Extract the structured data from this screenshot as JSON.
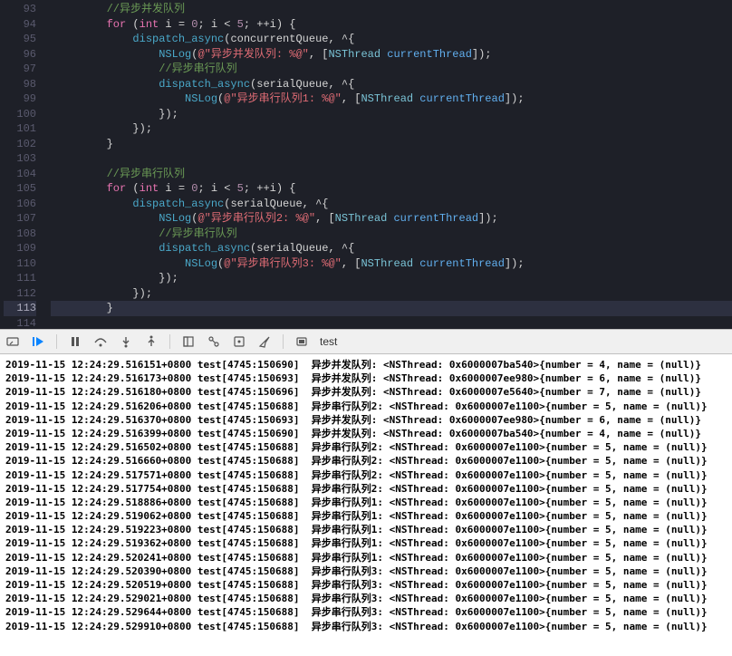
{
  "editor": {
    "lines": [
      {
        "num": 93,
        "tokens": [
          [
            "        ",
            ""
          ],
          [
            "//异步并发队列",
            "c-comment"
          ]
        ]
      },
      {
        "num": 94,
        "tokens": [
          [
            "        ",
            ""
          ],
          [
            "for",
            "c-keyword"
          ],
          [
            " (",
            ""
          ],
          [
            "int",
            "c-keyword"
          ],
          [
            " i = ",
            ""
          ],
          [
            "0",
            "c-num"
          ],
          [
            "; i < ",
            ""
          ],
          [
            "5",
            "c-num"
          ],
          [
            "; ++i) {",
            ""
          ]
        ]
      },
      {
        "num": 95,
        "tokens": [
          [
            "            ",
            ""
          ],
          [
            "dispatch_async",
            "c-func"
          ],
          [
            "(concurrentQueue, ^{",
            ""
          ]
        ]
      },
      {
        "num": 96,
        "tokens": [
          [
            "                ",
            ""
          ],
          [
            "NSLog",
            "c-func"
          ],
          [
            "(",
            ""
          ],
          [
            "@\"异步并发队列: %@\"",
            "c-str"
          ],
          [
            ", [",
            ""
          ],
          [
            "NSThread",
            "c-type"
          ],
          [
            " ",
            ""
          ],
          [
            "currentThread",
            "c-prop"
          ],
          [
            "]);",
            ""
          ]
        ]
      },
      {
        "num": 97,
        "tokens": [
          [
            "                ",
            ""
          ],
          [
            "//异步串行队列",
            "c-comment"
          ]
        ]
      },
      {
        "num": 98,
        "tokens": [
          [
            "                ",
            ""
          ],
          [
            "dispatch_async",
            "c-func"
          ],
          [
            "(serialQueue, ^{",
            ""
          ]
        ]
      },
      {
        "num": 99,
        "tokens": [
          [
            "                    ",
            ""
          ],
          [
            "NSLog",
            "c-func"
          ],
          [
            "(",
            ""
          ],
          [
            "@\"异步串行队列1: %@\"",
            "c-str"
          ],
          [
            ", [",
            ""
          ],
          [
            "NSThread",
            "c-type"
          ],
          [
            " ",
            ""
          ],
          [
            "currentThread",
            "c-prop"
          ],
          [
            "]);",
            ""
          ]
        ]
      },
      {
        "num": 100,
        "tokens": [
          [
            "                });",
            ""
          ]
        ]
      },
      {
        "num": 101,
        "tokens": [
          [
            "            });",
            ""
          ]
        ]
      },
      {
        "num": 102,
        "tokens": [
          [
            "        }",
            ""
          ]
        ]
      },
      {
        "num": 103,
        "tokens": [
          [
            "",
            ""
          ]
        ]
      },
      {
        "num": 104,
        "tokens": [
          [
            "        ",
            ""
          ],
          [
            "//异步串行队列",
            "c-comment"
          ]
        ]
      },
      {
        "num": 105,
        "tokens": [
          [
            "        ",
            ""
          ],
          [
            "for",
            "c-keyword"
          ],
          [
            " (",
            ""
          ],
          [
            "int",
            "c-keyword"
          ],
          [
            " i = ",
            ""
          ],
          [
            "0",
            "c-num"
          ],
          [
            "; i < ",
            ""
          ],
          [
            "5",
            "c-num"
          ],
          [
            "; ++i) {",
            ""
          ]
        ]
      },
      {
        "num": 106,
        "tokens": [
          [
            "            ",
            ""
          ],
          [
            "dispatch_async",
            "c-func"
          ],
          [
            "(serialQueue, ^{",
            ""
          ]
        ]
      },
      {
        "num": 107,
        "tokens": [
          [
            "                ",
            ""
          ],
          [
            "NSLog",
            "c-func"
          ],
          [
            "(",
            ""
          ],
          [
            "@\"异步串行队列2: %@\"",
            "c-str"
          ],
          [
            ", [",
            ""
          ],
          [
            "NSThread",
            "c-type"
          ],
          [
            " ",
            ""
          ],
          [
            "currentThread",
            "c-prop"
          ],
          [
            "]);",
            ""
          ]
        ]
      },
      {
        "num": 108,
        "tokens": [
          [
            "                ",
            ""
          ],
          [
            "//异步串行队列",
            "c-comment"
          ]
        ]
      },
      {
        "num": 109,
        "tokens": [
          [
            "                ",
            ""
          ],
          [
            "dispatch_async",
            "c-func"
          ],
          [
            "(serialQueue, ^{",
            ""
          ]
        ]
      },
      {
        "num": 110,
        "tokens": [
          [
            "                    ",
            ""
          ],
          [
            "NSLog",
            "c-func"
          ],
          [
            "(",
            ""
          ],
          [
            "@\"异步串行队列3: %@\"",
            "c-str"
          ],
          [
            ", [",
            ""
          ],
          [
            "NSThread",
            "c-type"
          ],
          [
            " ",
            ""
          ],
          [
            "currentThread",
            "c-prop"
          ],
          [
            "]);",
            ""
          ]
        ]
      },
      {
        "num": 111,
        "tokens": [
          [
            "                });",
            ""
          ]
        ]
      },
      {
        "num": 112,
        "tokens": [
          [
            "            });",
            ""
          ]
        ]
      },
      {
        "num": 113,
        "tokens": [
          [
            "        }",
            ""
          ]
        ],
        "current": true
      },
      {
        "num": 114,
        "tokens": [
          [
            "",
            ""
          ]
        ]
      }
    ]
  },
  "toolbar": {
    "target": "test"
  },
  "console": {
    "rows": [
      {
        "ts": "2019-11-15 12:24:29.516151+0800",
        "proc": "test[4745:150690]",
        "msg": "异步并发队列: <NSThread: 0x6000007ba540>{number = 4, name = (null)}"
      },
      {
        "ts": "2019-11-15 12:24:29.516173+0800",
        "proc": "test[4745:150693]",
        "msg": "异步并发队列: <NSThread: 0x6000007ee980>{number = 6, name = (null)}"
      },
      {
        "ts": "2019-11-15 12:24:29.516180+0800",
        "proc": "test[4745:150696]",
        "msg": "异步并发队列: <NSThread: 0x6000007e5640>{number = 7, name = (null)}"
      },
      {
        "ts": "2019-11-15 12:24:29.516206+0800",
        "proc": "test[4745:150688]",
        "msg": "异步串行队列2: <NSThread: 0x6000007e1100>{number = 5, name = (null)}"
      },
      {
        "ts": "2019-11-15 12:24:29.516370+0800",
        "proc": "test[4745:150693]",
        "msg": "异步并发队列: <NSThread: 0x6000007ee980>{number = 6, name = (null)}"
      },
      {
        "ts": "2019-11-15 12:24:29.516399+0800",
        "proc": "test[4745:150690]",
        "msg": "异步并发队列: <NSThread: 0x6000007ba540>{number = 4, name = (null)}"
      },
      {
        "ts": "2019-11-15 12:24:29.516502+0800",
        "proc": "test[4745:150688]",
        "msg": "异步串行队列2: <NSThread: 0x6000007e1100>{number = 5, name = (null)}"
      },
      {
        "ts": "2019-11-15 12:24:29.516660+0800",
        "proc": "test[4745:150688]",
        "msg": "异步串行队列2: <NSThread: 0x6000007e1100>{number = 5, name = (null)}"
      },
      {
        "ts": "2019-11-15 12:24:29.517571+0800",
        "proc": "test[4745:150688]",
        "msg": "异步串行队列2: <NSThread: 0x6000007e1100>{number = 5, name = (null)}"
      },
      {
        "ts": "2019-11-15 12:24:29.517754+0800",
        "proc": "test[4745:150688]",
        "msg": "异步串行队列2: <NSThread: 0x6000007e1100>{number = 5, name = (null)}"
      },
      {
        "ts": "2019-11-15 12:24:29.518886+0800",
        "proc": "test[4745:150688]",
        "msg": "异步串行队列1: <NSThread: 0x6000007e1100>{number = 5, name = (null)}"
      },
      {
        "ts": "2019-11-15 12:24:29.519062+0800",
        "proc": "test[4745:150688]",
        "msg": "异步串行队列1: <NSThread: 0x6000007e1100>{number = 5, name = (null)}"
      },
      {
        "ts": "2019-11-15 12:24:29.519223+0800",
        "proc": "test[4745:150688]",
        "msg": "异步串行队列1: <NSThread: 0x6000007e1100>{number = 5, name = (null)}"
      },
      {
        "ts": "2019-11-15 12:24:29.519362+0800",
        "proc": "test[4745:150688]",
        "msg": "异步串行队列1: <NSThread: 0x6000007e1100>{number = 5, name = (null)}"
      },
      {
        "ts": "2019-11-15 12:24:29.520241+0800",
        "proc": "test[4745:150688]",
        "msg": "异步串行队列1: <NSThread: 0x6000007e1100>{number = 5, name = (null)}"
      },
      {
        "ts": "2019-11-15 12:24:29.520390+0800",
        "proc": "test[4745:150688]",
        "msg": "异步串行队列3: <NSThread: 0x6000007e1100>{number = 5, name = (null)}"
      },
      {
        "ts": "2019-11-15 12:24:29.520519+0800",
        "proc": "test[4745:150688]",
        "msg": "异步串行队列3: <NSThread: 0x6000007e1100>{number = 5, name = (null)}"
      },
      {
        "ts": "2019-11-15 12:24:29.529021+0800",
        "proc": "test[4745:150688]",
        "msg": "异步串行队列3: <NSThread: 0x6000007e1100>{number = 5, name = (null)}"
      },
      {
        "ts": "2019-11-15 12:24:29.529644+0800",
        "proc": "test[4745:150688]",
        "msg": "异步串行队列3: <NSThread: 0x6000007e1100>{number = 5, name = (null)}"
      },
      {
        "ts": "2019-11-15 12:24:29.529910+0800",
        "proc": "test[4745:150688]",
        "msg": "异步串行队列3: <NSThread: 0x6000007e1100>{number = 5, name = (null)}"
      }
    ]
  }
}
